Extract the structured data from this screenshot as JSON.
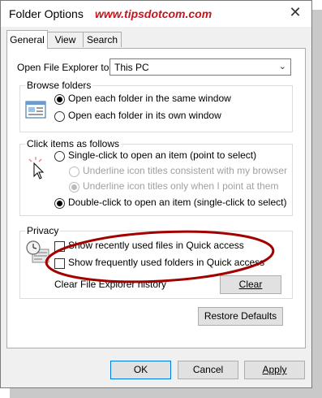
{
  "window": {
    "title": "Folder Options",
    "watermark": "www.tipsdotcom.com",
    "close_glyph": "✕"
  },
  "tabs": [
    {
      "label": "General",
      "active": true
    },
    {
      "label": "View",
      "active": false
    },
    {
      "label": "Search",
      "active": false
    }
  ],
  "open_explorer": {
    "label": "Open File Explorer to:",
    "value": "This PC",
    "chevron": "⌄"
  },
  "browse_folders": {
    "title": "Browse folders",
    "options": [
      {
        "label": "Open each folder in the same window",
        "checked": true
      },
      {
        "label": "Open each folder in its own window",
        "checked": false
      }
    ],
    "icon": "window-icon"
  },
  "click_items": {
    "title": "Click items as follows",
    "icon": "cursor-click-icon",
    "options": [
      {
        "label": "Single-click to open an item (point to select)",
        "checked": false,
        "enabled": true
      },
      {
        "label": "Underline icon titles consistent with my browser",
        "checked": false,
        "enabled": false
      },
      {
        "label": "Underline icon titles only when I point at them",
        "checked": true,
        "enabled": false
      },
      {
        "label": "Double-click to open an item (single-click to select)",
        "checked": true,
        "enabled": true
      }
    ]
  },
  "privacy": {
    "title": "Privacy",
    "icon": "clock-icon",
    "options": [
      {
        "label": "Show recently used files in Quick access",
        "checked": false
      },
      {
        "label": "Show frequently used folders in Quick access",
        "checked": false
      }
    ],
    "clear_label": "Clear File Explorer history",
    "clear_button": "Clear",
    "highlight_color": "#a30000"
  },
  "restore_button": "Restore Defaults",
  "footer": {
    "ok": "OK",
    "cancel": "Cancel",
    "apply": "Apply"
  },
  "colors": {
    "watermark": "#c4161c",
    "default_button_border": "#0078d7"
  }
}
